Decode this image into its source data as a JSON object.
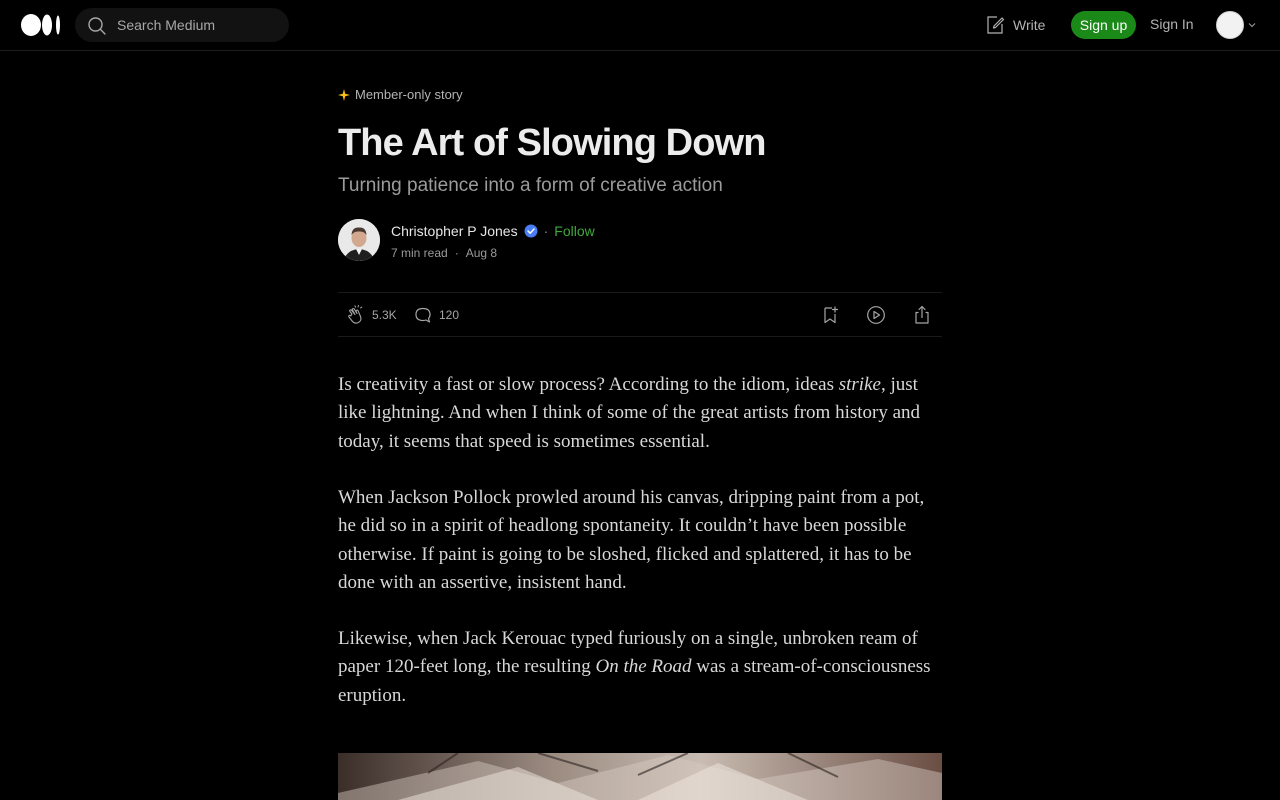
{
  "nav": {
    "search_placeholder": "Search Medium",
    "write_label": "Write",
    "signup_label": "Sign up",
    "signin_label": "Sign In"
  },
  "article": {
    "badge": "Member-only story",
    "title": "The Art of Slowing Down",
    "subtitle": "Turning patience into a form of creative action",
    "author": {
      "name": "Christopher P Jones",
      "follow_label": "Follow",
      "read_time": "7 min read",
      "date": "Aug 8"
    },
    "stats": {
      "claps": "5.3K",
      "responses": "120"
    },
    "paragraphs": [
      {
        "a": "Is creativity a fast or slow process? According to the idiom, ideas ",
        "em": "strike",
        "b": ", just like lightning. And when I think of some of the great artists from history and today, it seems that speed is sometimes essential."
      },
      {
        "a": "When Jackson Pollock prowled around his canvas, dripping paint from a pot, he did so in a spirit of headlong spontaneity. It couldn’t have been possible otherwise. If paint is going to be sloshed, flicked and splattered, it has to be done with an assertive, insistent hand."
      },
      {
        "a": "Likewise, when Jack Kerouac typed furiously on a single, unbroken ream of paper 120-feet long, the resulting ",
        "em": "On the Road",
        "b": " was a stream-of-consciousness eruption."
      }
    ]
  },
  "colors": {
    "background": "#000000",
    "accent_green": "#1a8917",
    "follow_green": "#3fa83b",
    "member_star": "#ffc017",
    "verified_blue": "#4a7ef7"
  },
  "icons": [
    "medium-logo-icon",
    "search-icon",
    "write-icon",
    "chevron-down-icon",
    "member-star-icon",
    "verified-badge-icon",
    "clap-icon",
    "response-icon",
    "bookmark-icon",
    "listen-icon",
    "share-icon"
  ]
}
